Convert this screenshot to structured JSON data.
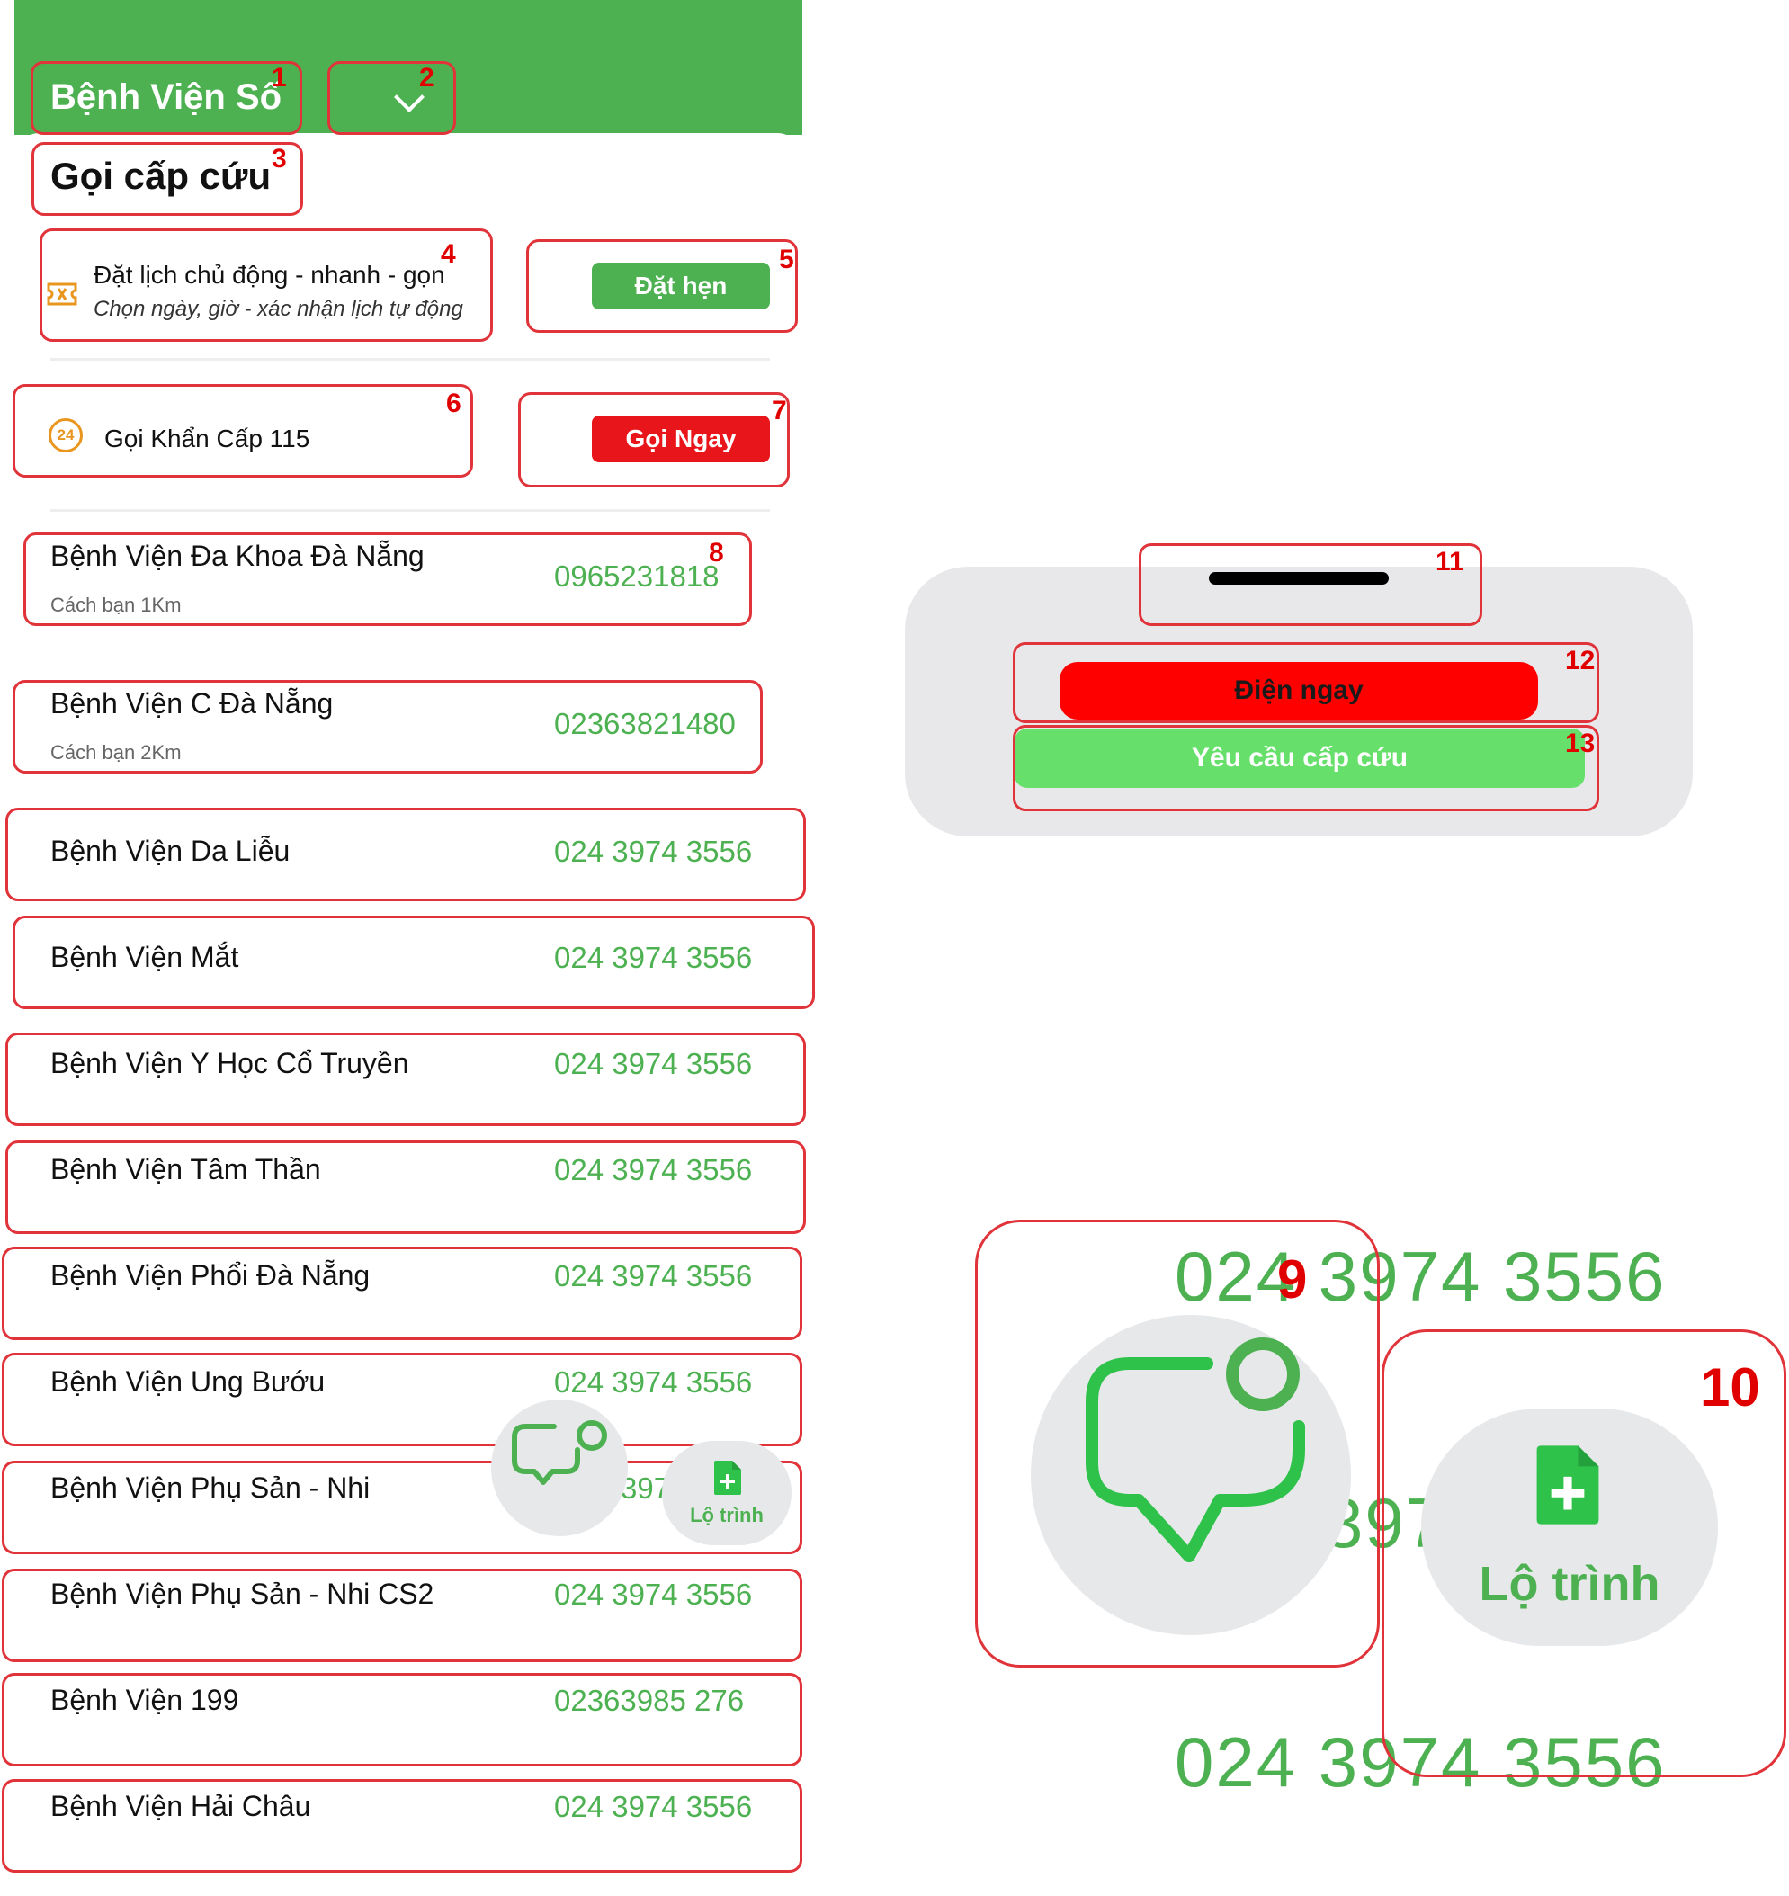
{
  "header": {
    "title": "Bệnh Viện Số",
    "title_marker": "1",
    "dropdown_marker": "2"
  },
  "section": {
    "title": "Gọi cấp cứu",
    "marker": "3"
  },
  "appointment": {
    "title": "Đặt lịch chủ động - nhanh - gọn",
    "subtitle": "Chọn ngày, giờ - xác nhận lịch tự động",
    "marker": "4",
    "button_label": "Đặt hẹn",
    "button_marker": "5"
  },
  "emergency": {
    "icon_text": "24",
    "title": "Gọi Khẩn Cấp 115",
    "marker": "6",
    "button_label": "Gọi Ngay",
    "button_marker": "7"
  },
  "hospitals": [
    {
      "name": "Bệnh Viện Đa Khoa Đà Nẵng",
      "distance": "Cách bạn 1Km",
      "phone": "0965231818",
      "marker": "8"
    },
    {
      "name": "Bệnh Viện C Đà Nẵng",
      "distance": "Cách bạn 2Km",
      "phone": "02363821480"
    },
    {
      "name": "Bệnh Viện Da Liễu",
      "phone": "024 3974 3556"
    },
    {
      "name": "Bệnh Viện Mắt",
      "phone": "024 3974 3556"
    },
    {
      "name": "Bệnh Viện Y Học Cổ Truyền",
      "phone": "024 3974 3556"
    },
    {
      "name": "Bệnh Viện Tâm Thần",
      "phone": "024 3974 3556"
    },
    {
      "name": "Bệnh Viện Phổi Đà Nẵng",
      "phone": "024 3974 3556"
    },
    {
      "name": "Bệnh Viện Ung Bướu",
      "phone": "024 3974 3556"
    },
    {
      "name": "Bệnh Viện Phụ Sản - Nhi",
      "phone": "397"
    },
    {
      "name": "Bệnh Viện Phụ Sản - Nhi CS2",
      "phone": "024 3974 3556"
    },
    {
      "name": "Bệnh Viện 199",
      "phone": "02363985 276"
    },
    {
      "name": "Bệnh Viện Hải Châu",
      "phone": "024 3974 3556"
    }
  ],
  "route_button": {
    "label": "Lộ trình"
  },
  "sheet": {
    "handle_marker": "11",
    "call_now_label": "Điện ngay",
    "call_now_marker": "12",
    "request_label": "Yêu cầu cấp cứu",
    "request_marker": "13"
  },
  "zoom": {
    "chat_marker": "9",
    "route_marker": "10",
    "route_label": "Lộ trình",
    "phone_top": "024 3974 3556",
    "phone_mid": "397",
    "phone_bottom": "024 3974 3556"
  },
  "colors": {
    "brand_green": "#4db152",
    "alert_red": "#e8151b",
    "highlight_red": "#e0343a",
    "sheet_gray": "#e8e8ea"
  }
}
